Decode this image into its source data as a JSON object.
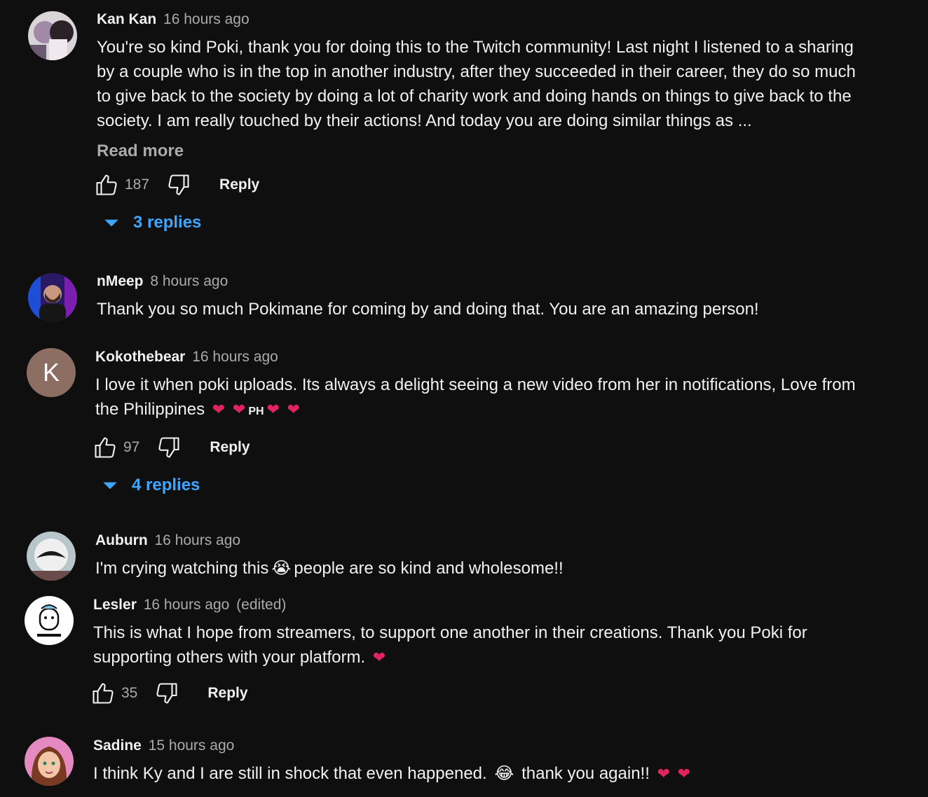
{
  "comments": [
    {
      "author": "Kan Kan",
      "time": "16 hours ago",
      "text": "You're so kind Poki, thank you for doing this to the Twitch community! Last night I listened to a sharing by a couple who is in the top in another industry, after they succeeded in their career, they do so much to give back to the society by doing a lot of charity work and doing hands on things to give back to the society. I am really touched by their actions! And today you are doing similar things as ...",
      "read_more": "Read more",
      "likes": "187",
      "reply": "Reply",
      "replies": "3 replies",
      "avatar_icon": "avatar-image"
    },
    {
      "author": "nMeep",
      "time": "8 hours ago",
      "text": "Thank you so much Pokimane for coming by and doing that. You are an amazing person!",
      "avatar_icon": "avatar-image"
    },
    {
      "author": "Kokothebear",
      "time": "16 hours ago",
      "text_a": "I love it when poki uploads. Its always a delight seeing a new video from her in notifications, Love from the Philippines",
      "flag": "PH",
      "likes": "97",
      "reply": "Reply",
      "replies": "4 replies",
      "avatar_letter": "K",
      "avatar_color": "#8d6e63"
    },
    {
      "author": "Auburn",
      "time": "16 hours ago",
      "text_a": "I'm crying watching this",
      "text_b": "people are so kind and wholesome!!",
      "avatar_icon": "avatar-image"
    },
    {
      "author": "Lesler",
      "time": "16 hours ago",
      "edited": "(edited)",
      "text_a": "This is what I hope from streamers, to support one another in their creations. Thank you Poki for supporting others with your platform.",
      "likes": "35",
      "reply": "Reply",
      "avatar_icon": "avatar-image"
    },
    {
      "author": "Sadine",
      "time": "15 hours ago",
      "text_a": "I think Ky and I are still in shock that even happened.",
      "text_b": "thank you again!!",
      "avatar_icon": "avatar-image"
    }
  ],
  "colors": {
    "background": "#0f0f0f",
    "text": "#f1f1f1",
    "secondary": "#aaaaaa",
    "link": "#3ea6ff",
    "heart": "#e0245e"
  }
}
